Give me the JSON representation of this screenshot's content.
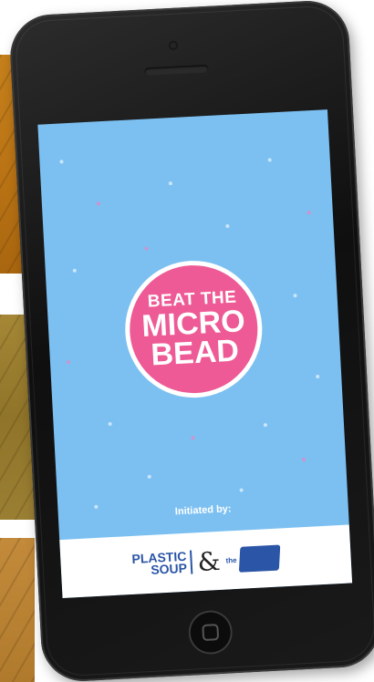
{
  "app": {
    "badge": {
      "line1": "BEAT THE",
      "line2": "MICRO",
      "line3": "BEAD"
    },
    "initiated_by": "Initiated by:",
    "partners": {
      "plastic_soup_line1": "PLASTIC",
      "plastic_soup_line2": "SOUP",
      "ampersand": "&",
      "partner2_prefix": "the",
      "partner2_name": ""
    }
  },
  "colors": {
    "screen_background": "#7cc0f2",
    "badge_pink": "#ee5a95",
    "logo_blue": "#2b55a6"
  },
  "icons": {
    "home_button": "home-button-icon",
    "earpiece": "speaker-icon",
    "camera": "camera-icon"
  }
}
